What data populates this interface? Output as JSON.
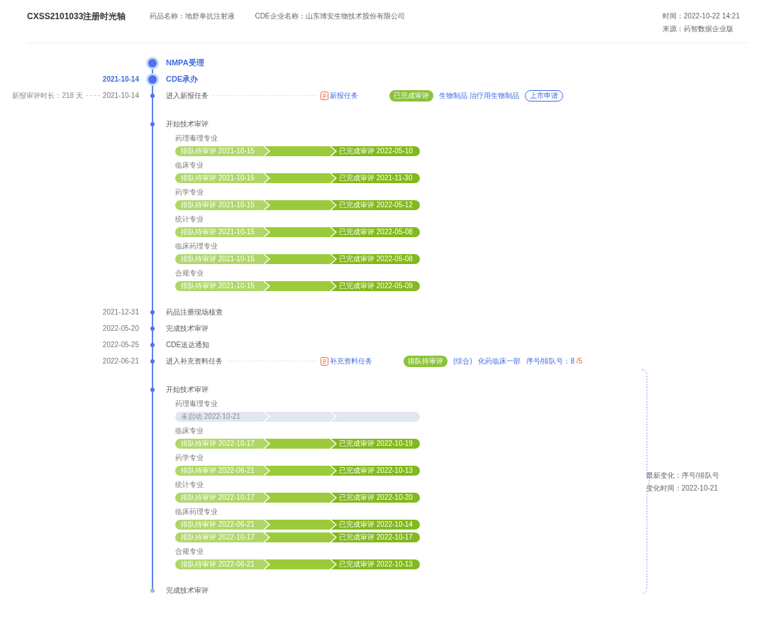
{
  "header": {
    "title": "CXSS2101033注册时光轴",
    "fields": [
      "药品名称：地舒单抗注射液",
      "CDE企业名称：山东博安生物技术股份有限公司"
    ],
    "time": "时间：2022-10-22 14:21",
    "source": "来源：药智数据企业版"
  },
  "phases": [
    {
      "events": [
        {
          "kind": "major",
          "label": "NMPA受理"
        },
        {
          "kind": "major",
          "date": "2021-10-14",
          "label": "CDE承办"
        },
        {
          "kind": "event",
          "date": "2021-10-14",
          "duration": "新报审评时长：218 天",
          "label": "进入新报任务",
          "task": "新报任务",
          "details": [
            {
              "kind": "status",
              "text": "已完成审评"
            },
            {
              "kind": "tag",
              "text": "生物制品 治疗用生物制品"
            },
            {
              "kind": "outline",
              "text": "上市申请"
            }
          ]
        },
        {
          "kind": "event",
          "label": "开始技术审评",
          "spaced": true
        },
        {
          "kind": "review",
          "specialties": [
            {
              "name": "药理毒理专业",
              "bars": [
                {
                  "started": true,
                  "start": "排队待审评  2021-10-15",
                  "end": "已完成审评  2022-05-10"
                }
              ]
            },
            {
              "name": "临床专业",
              "bars": [
                {
                  "started": true,
                  "start": "排队待审评  2021-10-15",
                  "end": "已完成审评  2021-11-30"
                }
              ]
            },
            {
              "name": "药学专业",
              "bars": [
                {
                  "started": true,
                  "start": "排队待审评  2021-10-15",
                  "end": "已完成审评  2022-05-12"
                }
              ]
            },
            {
              "name": "统计专业",
              "bars": [
                {
                  "started": true,
                  "start": "排队待审评  2021-10-15",
                  "end": "已完成审评  2022-05-08"
                }
              ]
            },
            {
              "name": "临床药理专业",
              "bars": [
                {
                  "started": true,
                  "start": "排队待审评  2021-10-15",
                  "end": "已完成审评  2022-05-08"
                }
              ]
            },
            {
              "name": "合规专业",
              "bars": [
                {
                  "started": true,
                  "start": "排队待审评  2021-10-15",
                  "end": "已完成审评  2022-05-09"
                }
              ]
            }
          ]
        },
        {
          "kind": "event",
          "date": "2021-12-31",
          "label": "药品注册现场核查"
        },
        {
          "kind": "event",
          "date": "2022-05-20",
          "label": "完成技术审评"
        },
        {
          "kind": "event",
          "date": "2022-05-25",
          "label": "CDE送达通知"
        },
        {
          "kind": "event",
          "date": "2022-06-21",
          "label": "进入补充资料任务",
          "task": "补充资料任务",
          "details": [
            {
              "kind": "status",
              "text": "排队待审评"
            },
            {
              "kind": "tag",
              "text": "(综合)"
            },
            {
              "kind": "tag",
              "text": "化药临床一部"
            },
            {
              "kind": "queue",
              "text": "序号/排队号：",
              "value": "8",
              "total": "/5"
            }
          ]
        }
      ]
    },
    {
      "note": [
        "最新变化：序号/排队号",
        "变化时间：2022-10-21"
      ],
      "events": [
        {
          "kind": "event",
          "label": "开始技术审评",
          "spaced": true
        },
        {
          "kind": "review",
          "specialties": [
            {
              "name": "药理毒理专业",
              "bars": [
                {
                  "started": false,
                  "start": "未启动  2022-10-21"
                }
              ]
            },
            {
              "name": "临床专业",
              "bars": [
                {
                  "started": true,
                  "start": "排队待审评  2022-10-17",
                  "end": "已完成审评  2022-10-19"
                }
              ]
            },
            {
              "name": "药学专业",
              "bars": [
                {
                  "started": true,
                  "start": "排队待审评  2022-06-21",
                  "end": "已完成审评  2022-10-13"
                }
              ]
            },
            {
              "name": "统计专业",
              "bars": [
                {
                  "started": true,
                  "start": "排队待审评  2022-10-17",
                  "end": "已完成审评  2022-10-20"
                }
              ]
            },
            {
              "name": "临床药理专业",
              "bars": [
                {
                  "started": true,
                  "start": "排队待审评  2022-06-21",
                  "end": "已完成审评  2022-10-14"
                },
                {
                  "started": true,
                  "start": "排队待审评  2022-10-17",
                  "end": "已完成审评  2022-10-17"
                }
              ]
            },
            {
              "name": "合规专业",
              "bars": [
                {
                  "started": true,
                  "start": "排队待审评  2022-06-21",
                  "end": "已完成审评  2022-10-13"
                }
              ]
            }
          ]
        },
        {
          "kind": "end",
          "label": "完成技术审评"
        }
      ]
    }
  ]
}
